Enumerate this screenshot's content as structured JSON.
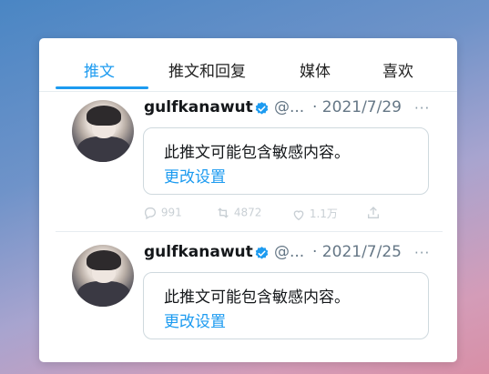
{
  "tabs": [
    {
      "label": "推文",
      "active": true
    },
    {
      "label": "推文和回复",
      "active": false
    },
    {
      "label": "媒体",
      "active": false
    },
    {
      "label": "喜欢",
      "active": false
    }
  ],
  "tweets": [
    {
      "author_name": "gulfkanawut",
      "handle": "@...",
      "date": "· 2021/7/29",
      "more": "···",
      "sensitive_message": "此推文可能包含敏感内容。",
      "change_settings": "更改设置",
      "reply_count": "991",
      "retweet_count": "4872",
      "like_count": "1.1万"
    },
    {
      "author_name": "gulfkanawut",
      "handle": "@...",
      "date": "· 2021/7/25",
      "more": "···",
      "sensitive_message": "此推文可能包含敏感内容。",
      "change_settings": "更改设置"
    }
  ],
  "colors": {
    "accent": "#1d9bf0",
    "text": "#14171a",
    "muted": "#657786",
    "border": "#cfd9de"
  },
  "icons": [
    "verified-badge-icon",
    "reply-icon",
    "retweet-icon",
    "like-icon",
    "share-icon",
    "more-icon"
  ]
}
